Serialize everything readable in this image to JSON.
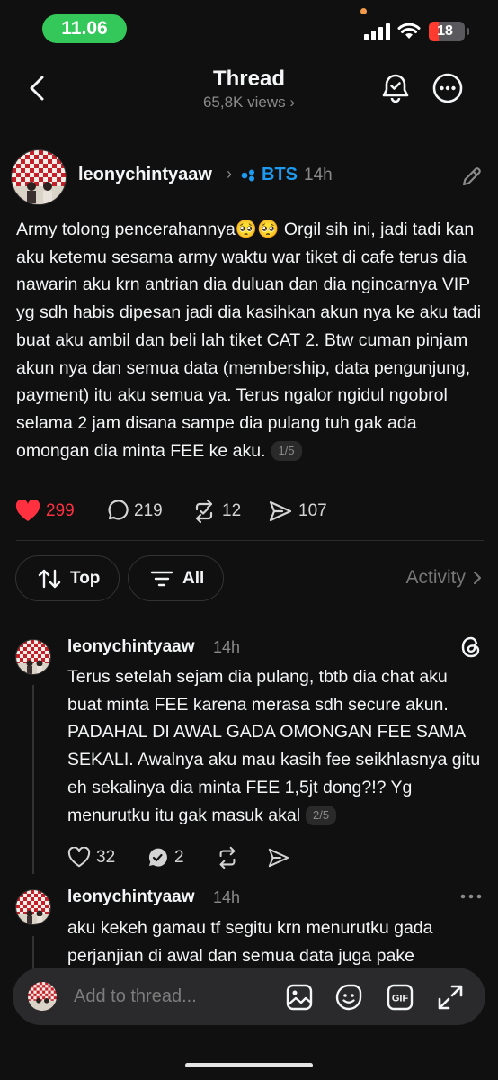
{
  "status_bar": {
    "time": "11.06",
    "battery": "18"
  },
  "nav": {
    "title": "Thread",
    "views": "65,8K views ›"
  },
  "post": {
    "username": "leonychintyaaw",
    "separator": "›",
    "topic": "BTS",
    "time": "14h",
    "text": "Army tolong pencerahannya🥺🥺 Orgil sih ini, jadi tadi kan aku ketemu sesama army waktu war tiket di cafe terus dia nawarin aku krn antrian dia duluan dan dia ngincarnya VIP yg sdh habis dipesan jadi dia kasihkan akun nya ke aku tadi buat aku ambil dan beli lah tiket CAT 2. Btw cuman pinjam akun nya dan semua data (membership, data pengunjung, payment) itu aku semua ya. Terus ngalor ngidul ngobrol selama 2 jam disana sampe dia pulang tuh gak ada omongan dia minta FEE ke aku.",
    "page": "1/5",
    "likes": "299",
    "replies": "219",
    "reposts": "12",
    "shares": "107"
  },
  "filters": {
    "sort": "Top",
    "filter": "All",
    "activity": "Activity"
  },
  "replies": [
    {
      "username": "leonychintyaaw",
      "time": "14h",
      "text": "Terus setelah sejam dia pulang, tbtb dia chat aku buat minta FEE karena merasa sdh secure akun. PADAHAL DI AWAL GADA OMONGAN FEE SAMA SEKALI. Awalnya aku mau kasih fee seikhlasnya gitu eh sekalinya dia minta FEE 1,5jt dong?!? Yg menurutku itu gak masuk akal",
      "page": "2/5",
      "likes": "32",
      "replies": "2"
    },
    {
      "username": "leonychintyaaw",
      "time": "14h",
      "text": "aku kekeh gamau tf segitu krn menurutku gada perjanjian di awal dan semua data juga pake"
    }
  ],
  "composer": {
    "placeholder": "Add to thread..."
  },
  "colors": {
    "like": "#ff3040",
    "topic": "#1e9bf0",
    "time_pill": "#34c759"
  }
}
